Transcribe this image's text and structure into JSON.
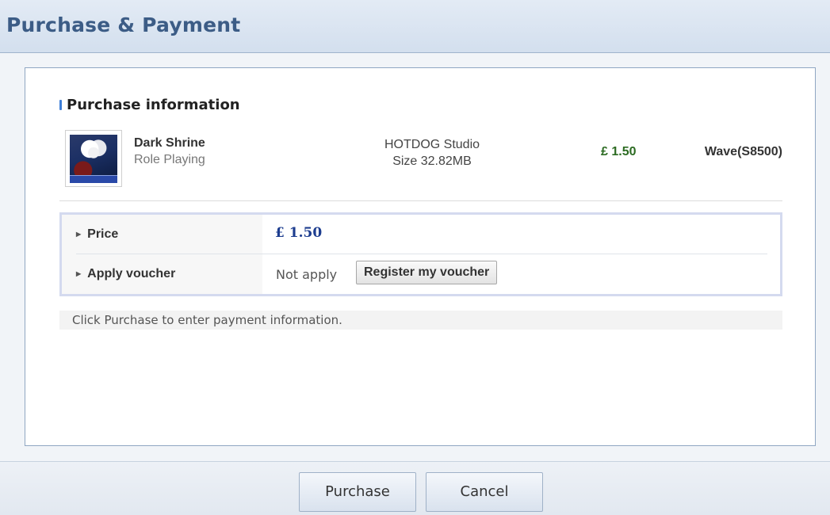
{
  "window": {
    "title": "Purchase & Payment"
  },
  "section": {
    "title": "Purchase information"
  },
  "product": {
    "name": "Dark Shrine",
    "genre": "Role Playing",
    "developer": "HOTDOG Studio",
    "size": "Size  32.82MB",
    "price": "£ 1.50",
    "carrier": "Wave(S8500)",
    "thumbnail_icon": "game-thumbnail"
  },
  "summary": {
    "price_label": "Price",
    "price_value": "£ 1.50",
    "voucher_label": "Apply voucher",
    "voucher_status": "Not apply",
    "voucher_button": "Register my voucher"
  },
  "note": "Click Purchase to enter payment information.",
  "footer": {
    "purchase_label": "Purchase",
    "cancel_label": "Cancel"
  },
  "colors": {
    "title": "#3c5c86",
    "accent_bar": "#3f7fd8",
    "price_green": "#2c6b22",
    "price_blue": "#1d3d8f"
  }
}
